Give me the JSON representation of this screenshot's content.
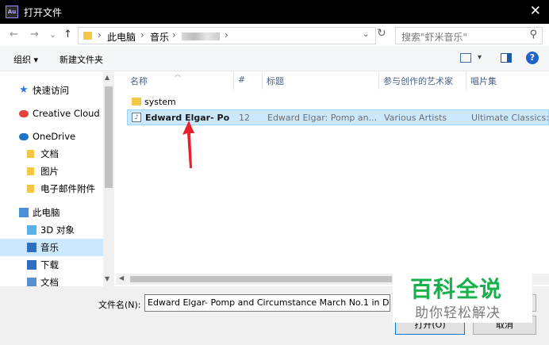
{
  "window": {
    "app_icon": "Au",
    "title": "打开文件",
    "close_icon": "✕"
  },
  "nav": {
    "back_icon": "←",
    "forward_icon": "→",
    "recent_icon": "⌄",
    "up_icon": "↑",
    "breadcrumb": [
      "此电脑",
      "音乐"
    ],
    "separator": "›",
    "refresh_icon": "↻",
    "search_placeholder": "搜索\"虾米音乐\"",
    "search_icon": "⚲"
  },
  "toolbar": {
    "organize": "组织 ▾",
    "new_folder": "新建文件夹",
    "help_icon": "?"
  },
  "sidebar": {
    "items": [
      {
        "label": "快速访问",
        "icon": "star-icon",
        "color": "#2f7bd9",
        "indent": 0
      },
      {
        "label": "Creative Cloud F",
        "icon": "creative-cloud-icon",
        "color": "#e3443b",
        "indent": 0
      },
      {
        "label": "OneDrive",
        "icon": "cloud-icon",
        "color": "#1e73c9",
        "indent": 0
      },
      {
        "label": "文档",
        "icon": "folder-icon",
        "color": "#f2c744",
        "indent": 1
      },
      {
        "label": "图片",
        "icon": "folder-icon",
        "color": "#f2c744",
        "indent": 1
      },
      {
        "label": "电子邮件附件",
        "icon": "folder-icon",
        "color": "#f2c744",
        "indent": 1
      },
      {
        "label": "此电脑",
        "icon": "computer-icon",
        "color": "#4a90d9",
        "indent": 0
      },
      {
        "label": "3D 对象",
        "icon": "3d-objects-icon",
        "color": "#5ab0e8",
        "indent": 1
      },
      {
        "label": "音乐",
        "icon": "music-icon",
        "color": "#2f6fc0",
        "indent": 1,
        "selected": true
      },
      {
        "label": "下载",
        "icon": "download-icon",
        "color": "#2f6fc0",
        "indent": 1
      },
      {
        "label": "文档",
        "icon": "document-icon",
        "color": "#5a8fd0",
        "indent": 1
      }
    ]
  },
  "filelist": {
    "columns": [
      "名称",
      "#",
      "标题",
      "参与创作的艺术家",
      "唱片集"
    ],
    "rows": [
      {
        "name": "system",
        "number": "",
        "title": "",
        "artist": "",
        "album": "",
        "icon": "folder-icon"
      },
      {
        "name": "Edward Elgar- Po...",
        "number": "12",
        "title": "Edward Elgar: Pomp an...",
        "artist": "Various Artists",
        "album": "Ultimate Classics: T",
        "icon": "audio-file-icon",
        "selected": true
      }
    ]
  },
  "bottom": {
    "filename_label": "文件名(N):",
    "filename_value": "Edward Elgar- Pomp and Circumstance March No.1 in D",
    "open_label": "打开(O)",
    "cancel_label": "取消"
  },
  "watermark": {
    "title": "百科全说",
    "subtitle": "助你轻松解决",
    "color": "#18b04a"
  },
  "annotation": {
    "arrow_color": "#e8202a"
  }
}
